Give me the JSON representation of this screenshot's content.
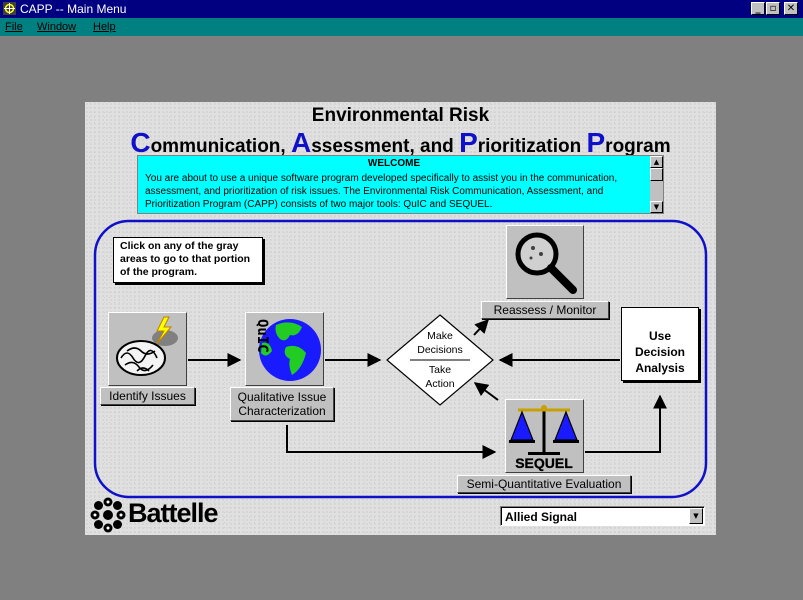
{
  "window": {
    "title": "CAPP -- Main Menu",
    "icon": "capp-app-icon",
    "controls": {
      "minimize": "_",
      "maximize": "▫",
      "close": "✕"
    }
  },
  "menubar": {
    "items": [
      {
        "label": "File"
      },
      {
        "label": "Window"
      },
      {
        "label": "Help"
      }
    ]
  },
  "header": {
    "line1": "Environmental Risk",
    "line2": [
      {
        "cap": "C",
        "rest": "ommunication, "
      },
      {
        "cap": "A",
        "rest": "ssessment, and "
      },
      {
        "cap": "P",
        "rest": "rioritization "
      },
      {
        "cap": "P",
        "rest": "rogram"
      }
    ]
  },
  "welcome": {
    "title": "WELCOME",
    "body": "You are about to use a unique software program developed specifically to assist you in the communication, assessment, and prioritization of risk issues.  The Environmental Risk Communication, Assessment, and Prioritization Program (CAPP) consists of two major tools:  QuIC and SEQUEL.",
    "scroll_up": "▲",
    "scroll_down": "▼"
  },
  "instructions": "Click on any of the gray areas to go to that portion of the program.",
  "flow": {
    "identify": {
      "label": "Identify Issues",
      "icon": "brain-lightning-icon"
    },
    "qualitative": {
      "label_line1": "Qualitative Issue",
      "label_line2": "Characterization",
      "icon": "quic-globe-icon",
      "icon_text": "QuIC"
    },
    "decision": {
      "line1": "Make",
      "line2": "Decisions",
      "line3": "Take",
      "line4": "Action"
    },
    "reassess": {
      "label": "Reassess / Monitor",
      "icon": "magnifier-icon"
    },
    "sequel": {
      "label": "Semi-Quantitative Evaluation",
      "icon": "scales-icon",
      "icon_text": "SEQUEL"
    },
    "decision_analysis": {
      "line1": "Use",
      "line2": "Decision",
      "line3": "Analysis"
    }
  },
  "footer": {
    "logo_text": "Battelle",
    "logo_icon": "battelle-logo-icon",
    "sponsor_select": {
      "value": "Allied Signal",
      "arrow": "▼"
    }
  },
  "colors": {
    "titlebar": "#000080",
    "menubar": "#008080",
    "desktop": "#808080",
    "welcome_bg": "#00ffff",
    "accent_blue": "#1010c8"
  }
}
